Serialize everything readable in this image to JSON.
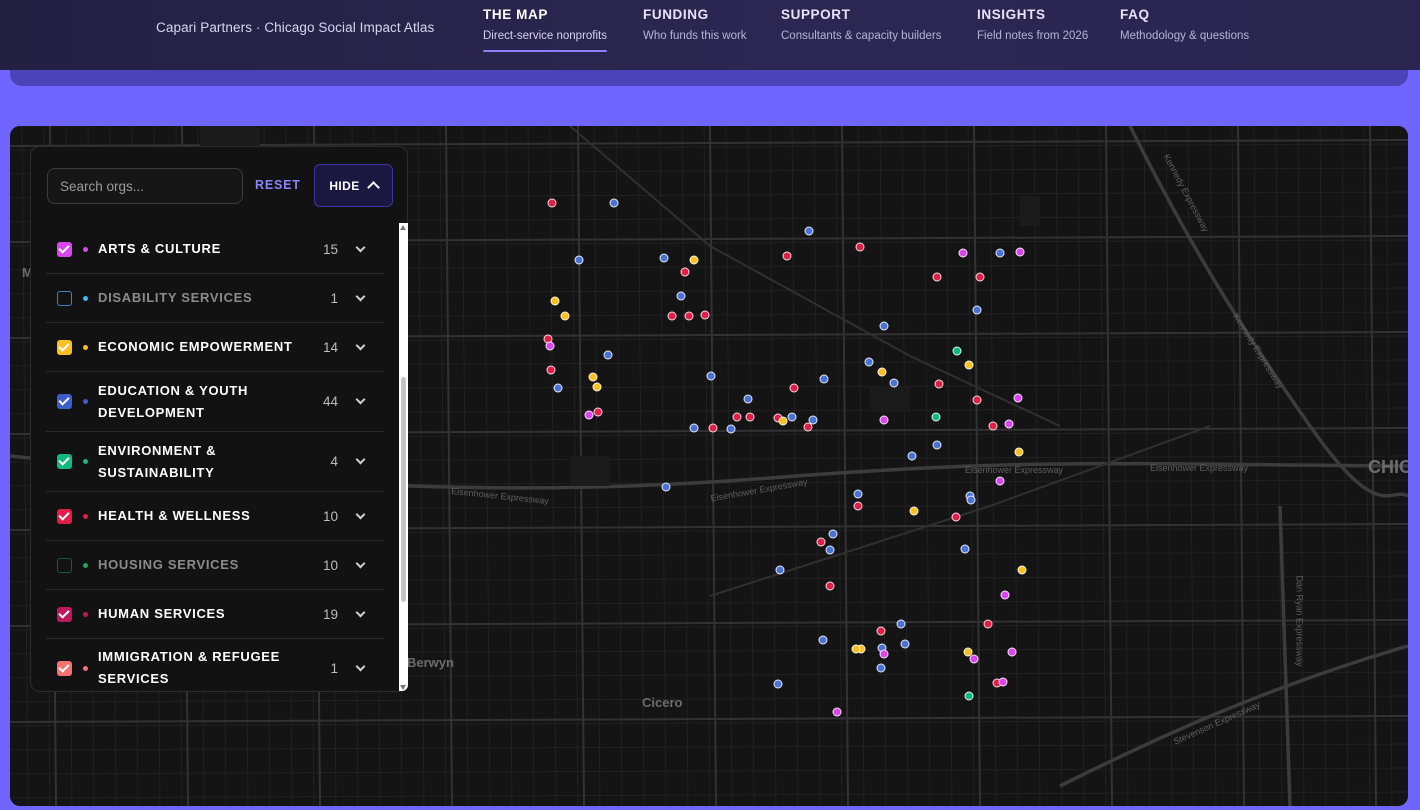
{
  "brand": "Capari Partners · Chicago Social Impact Atlas",
  "nav": [
    {
      "title": "THE MAP",
      "sub": "Direct-service nonprofits",
      "active": true
    },
    {
      "title": "FUNDING",
      "sub": "Who funds this work",
      "active": false
    },
    {
      "title": "SUPPORT",
      "sub": "Consultants & capacity builders",
      "active": false
    },
    {
      "title": "INSIGHTS",
      "sub": "Field notes from 2026",
      "active": false
    },
    {
      "title": "FAQ",
      "sub": "Methodology & questions",
      "active": false
    }
  ],
  "panel": {
    "search_placeholder": "Search orgs...",
    "reset_label": "RESET",
    "hide_label": "HIDE",
    "categories": [
      {
        "name": "ARTS & CULTURE",
        "count": "15",
        "checked": true,
        "color": "#d946ef"
      },
      {
        "name": "DISABILITY SERVICES",
        "count": "1",
        "checked": false,
        "color": "#38bdf8"
      },
      {
        "name": "ECONOMIC EMPOWERMENT",
        "count": "14",
        "checked": true,
        "color": "#fbbf24"
      },
      {
        "name": "EDUCATION & YOUTH DEVELOPMENT",
        "count": "44",
        "checked": true,
        "color": "#3b5fc8"
      },
      {
        "name": "ENVIRONMENT & SUSTAINABILITY",
        "count": "4",
        "checked": true,
        "color": "#10b981"
      },
      {
        "name": "HEALTH & WELLNESS",
        "count": "10",
        "checked": true,
        "color": "#e11d48"
      },
      {
        "name": "HOUSING SERVICES",
        "count": "10",
        "checked": false,
        "color": "#22a35a"
      },
      {
        "name": "HUMAN SERVICES",
        "count": "19",
        "checked": true,
        "color": "#be185d"
      },
      {
        "name": "IMMIGRATION & REFUGEE SERVICES",
        "count": "1",
        "checked": true,
        "color": "#f87171"
      }
    ]
  },
  "map": {
    "labels": [
      "Berwyn",
      "Cicero",
      "CHIC",
      "M"
    ],
    "road_labels": [
      "Eisenhower Expressway",
      "Eisenhower Expressway",
      "Eisenhower Expressway",
      "Eisenhower Expressway",
      "Kennedy Expressway",
      "Kennedy Expressway",
      "Dan Ryan Expressway",
      "Stevenson Expressway"
    ],
    "marker_colors": {
      "arts": "#d946ef",
      "econ": "#fbbf24",
      "edu": "#4a72d6",
      "env": "#10b981",
      "health": "#e11d48",
      "human": "#be185d"
    }
  }
}
